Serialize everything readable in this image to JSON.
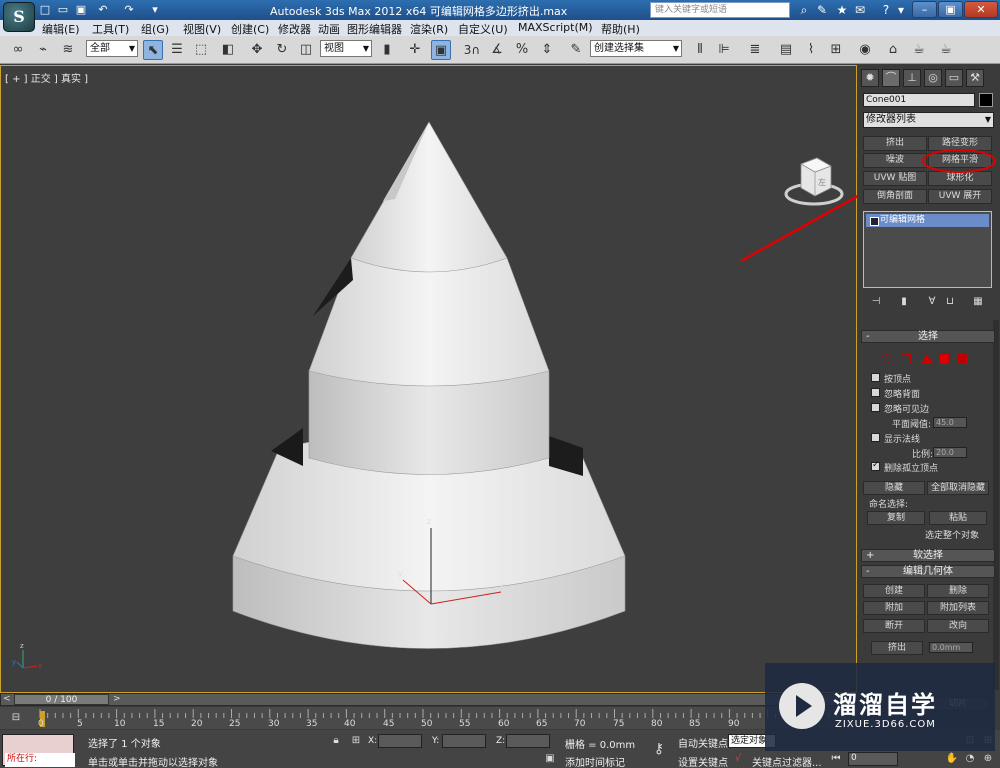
{
  "titlebar": {
    "title": "Autodesk 3ds Max  2012 x64        可编辑网格多边形挤出.max",
    "search_placeholder": "键入关键字或短语",
    "quick_access_icons": [
      "new-icon",
      "open-icon",
      "save-icon",
      "undo-icon",
      "redo-icon",
      "dropdown-icon"
    ]
  },
  "menu": {
    "items": [
      "编辑(E)",
      "工具(T)",
      "组(G)",
      "视图(V)",
      "创建(C)",
      "修改器",
      "动画",
      "图形编辑器",
      "渲染(R)",
      "自定义(U)",
      "MAXScript(M)",
      "帮助(H)"
    ]
  },
  "toolbar": {
    "selection_filter": "全部",
    "reference_coord": "视图",
    "named_selection": "创建选择集",
    "snap_label": "3"
  },
  "viewport": {
    "label": "[ + ] 正交 ] 真实 ]",
    "viewcube_label": "左",
    "axis_labels": {
      "x": "x",
      "y": "y",
      "z": "z"
    }
  },
  "command_panel": {
    "object_name": "Cone001",
    "object_color": "#000000",
    "modifier_list": "修改器列表",
    "modifier_buttons": [
      "挤出",
      "路径变形",
      "噪波",
      "网格平滑",
      "UVW 贴图",
      "球形化",
      "倒角剖面",
      "UVW 展开"
    ],
    "highlighted_button": "网格平滑",
    "stack_item": "可编辑网格"
  },
  "selection_rollout": {
    "title": "选择",
    "options": [
      {
        "label": "按顶点",
        "checked": false
      },
      {
        "label": "忽略背面",
        "checked": false
      },
      {
        "label": "忽略可见边",
        "checked": false
      }
    ],
    "plane_threshold_label": "平面阈值:",
    "plane_threshold_value": "45.0",
    "show_normals_label": "显示法线",
    "show_normals_checked": false,
    "scale_label": "比例:",
    "scale_value": "20.0",
    "delete_isolated_label": "删除孤立顶点",
    "delete_isolated_checked": true,
    "hide_btn": "隐藏",
    "unhide_all_btn": "全部取消隐藏",
    "named_sel_label": "命名选择:",
    "copy_btn": "复制",
    "paste_btn": "粘贴",
    "select_whole_label": "选定整个对象"
  },
  "soft_select_rollout": {
    "title": "软选择"
  },
  "edit_geometry_rollout": {
    "title": "编辑几何体",
    "buttons": [
      "创建",
      "删除",
      "附加",
      "附加列表",
      "断开",
      "改向"
    ],
    "extrude_btn": "挤出",
    "extrude_value": "0.0mm",
    "slice_btn": "切片"
  },
  "timeline": {
    "position": "0 / 100",
    "ticks": [
      "0",
      "5",
      "10",
      "15",
      "20",
      "25",
      "30",
      "35",
      "40",
      "45",
      "50",
      "55",
      "60",
      "65",
      "70",
      "75",
      "80",
      "85",
      "90"
    ]
  },
  "statusbar": {
    "running_label": "所在行:",
    "selection_info": "选择了 1 个对象",
    "prompt": "单击或单击并拖动以选择对象",
    "x_label": "X:",
    "y_label": "Y:",
    "z_label": "Z:",
    "grid": "栅格 = 0.0mm",
    "add_time_tag": "添加时间标记",
    "auto_key": "自动关键点",
    "set_key": "设置关键点",
    "selected_set": "选定对象",
    "key_filters": "关键点过滤器...",
    "frame_value": "0"
  },
  "watermark": {
    "title": "溜溜自学",
    "url": "ZIXUE.3D66.COM"
  },
  "colors": {
    "viewport_bg": "#3e3e3e",
    "viewport_border": "#c9a227",
    "annotation_red": "#e00000",
    "stack_highlight": "#6a8cc8"
  }
}
